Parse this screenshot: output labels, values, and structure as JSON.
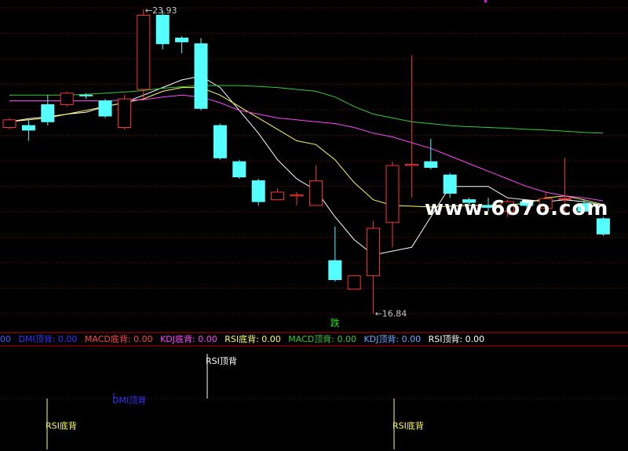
{
  "chart_data": {
    "type": "candlestick",
    "price_range": [
      16.0,
      24.0
    ],
    "grid": true,
    "candles": [
      {
        "o": 20.85,
        "c": 21.05,
        "h": 21.1,
        "l": 20.8
      },
      {
        "o": 20.9,
        "c": 20.78,
        "h": 21.05,
        "l": 20.5
      },
      {
        "o": 21.45,
        "c": 21.0,
        "h": 21.7,
        "l": 20.9
      },
      {
        "o": 21.45,
        "c": 21.75,
        "h": 21.8,
        "l": 21.4
      },
      {
        "o": 21.7,
        "c": 21.68,
        "h": 21.75,
        "l": 21.6
      },
      {
        "o": 21.55,
        "c": 21.15,
        "h": 21.6,
        "l": 21.1
      },
      {
        "o": 20.85,
        "c": 21.6,
        "h": 21.7,
        "l": 20.8
      },
      {
        "o": 21.85,
        "c": 23.8,
        "h": 23.95,
        "l": 21.6
      },
      {
        "o": 23.8,
        "c": 23.05,
        "h": 23.93,
        "l": 22.9
      },
      {
        "o": 23.2,
        "c": 23.1,
        "h": 23.25,
        "l": 22.8
      },
      {
        "o": 23.05,
        "c": 21.35,
        "h": 23.2,
        "l": 21.3
      },
      {
        "o": 20.9,
        "c": 20.05,
        "h": 20.95,
        "l": 20.0
      },
      {
        "o": 19.95,
        "c": 19.55,
        "h": 20.0,
        "l": 19.5
      },
      {
        "o": 19.45,
        "c": 18.9,
        "h": 19.5,
        "l": 18.8
      },
      {
        "o": 18.95,
        "c": 19.15,
        "h": 19.25,
        "l": 18.95
      },
      {
        "o": 19.05,
        "c": 19.08,
        "h": 19.15,
        "l": 18.8
      },
      {
        "o": 18.8,
        "c": 19.45,
        "h": 19.85,
        "l": 18.8
      },
      {
        "o": 17.35,
        "c": 16.85,
        "h": 18.25,
        "l": 16.8
      },
      {
        "o": 16.6,
        "c": 16.95,
        "h": 16.95,
        "l": 16.6
      },
      {
        "o": 16.95,
        "c": 18.2,
        "h": 18.4,
        "l": 15.96
      },
      {
        "o": 18.35,
        "c": 19.85,
        "h": 19.95,
        "l": 17.7
      },
      {
        "o": 19.85,
        "c": 19.88,
        "h": 22.75,
        "l": 19.0
      },
      {
        "o": 19.95,
        "c": 19.8,
        "h": 20.55,
        "l": 19.75
      },
      {
        "o": 19.6,
        "c": 19.12,
        "h": 19.65,
        "l": 19.0
      },
      {
        "o": 18.95,
        "c": 18.88,
        "h": 19.0,
        "l": 18.8
      },
      {
        "o": 18.8,
        "c": 18.75,
        "h": 19.0,
        "l": 18.65
      },
      {
        "o": 18.65,
        "c": 18.9,
        "h": 18.95,
        "l": 18.5
      },
      {
        "o": 18.9,
        "c": 18.8,
        "h": 18.95,
        "l": 18.75
      },
      {
        "o": 18.72,
        "c": 18.98,
        "h": 19.15,
        "l": 18.72
      },
      {
        "o": 18.98,
        "c": 18.98,
        "h": 20.05,
        "l": 18.55
      },
      {
        "o": 18.85,
        "c": 18.65,
        "h": 18.95,
        "l": 18.62
      },
      {
        "o": 18.45,
        "c": 18.05,
        "h": 18.5,
        "l": 18.0
      }
    ],
    "moving_averages": [
      {
        "name": "MA5",
        "color": "#ffffff",
        "values": [
          21.0,
          21.08,
          21.13,
          21.2,
          21.25,
          21.4,
          21.5,
          21.7,
          21.9,
          22.1,
          22.2,
          21.9,
          21.3,
          20.7,
          20.0,
          19.5,
          19.2,
          18.5,
          17.9,
          17.5,
          17.6,
          17.7,
          18.5,
          19.3,
          19.3,
          19.3,
          19.0,
          18.95,
          18.9,
          18.95,
          18.9,
          18.8
        ]
      },
      {
        "name": "MA10",
        "color": "#ffff55",
        "values": [
          21.0,
          21.05,
          21.1,
          21.2,
          21.3,
          21.4,
          21.5,
          21.6,
          21.8,
          21.9,
          21.9,
          21.7,
          21.4,
          21.1,
          20.8,
          20.5,
          20.4,
          20.0,
          19.4,
          18.95,
          18.8,
          18.78,
          18.76,
          18.78,
          18.8,
          18.8,
          18.82,
          18.85,
          19.0,
          19.05,
          18.95,
          18.82
        ]
      },
      {
        "name": "MA20",
        "color": "#ff44ff",
        "values": [
          21.55,
          21.55,
          21.55,
          21.55,
          21.55,
          21.55,
          21.57,
          21.58,
          21.65,
          21.7,
          21.65,
          21.5,
          21.3,
          21.2,
          21.1,
          21.05,
          21.0,
          20.95,
          20.85,
          20.7,
          20.6,
          20.45,
          20.3,
          20.1,
          19.9,
          19.7,
          19.5,
          19.3,
          19.15,
          19.05,
          19.0,
          18.92
        ]
      },
      {
        "name": "MA60",
        "color": "#33cc33",
        "values": [
          21.7,
          21.7,
          21.7,
          21.7,
          21.72,
          21.75,
          21.78,
          21.82,
          21.88,
          21.92,
          21.95,
          21.95,
          21.95,
          21.93,
          21.9,
          21.85,
          21.8,
          21.65,
          21.4,
          21.2,
          21.1,
          21.0,
          20.95,
          20.9,
          20.87,
          20.85,
          20.83,
          20.8,
          20.78,
          20.75,
          20.72,
          20.7
        ]
      }
    ],
    "annotations": [
      {
        "text": "23.93",
        "candle": 7,
        "price": 23.93
      },
      {
        "text": "16.84",
        "candle": 19,
        "price": 15.96
      },
      {
        "text": "跌",
        "candle": 17,
        "price": 15.75
      }
    ],
    "signals": [
      {
        "candle": 5,
        "label": "DMI顶背",
        "color": "#3333ff",
        "level": 0.45
      },
      {
        "candle": 10,
        "label": "RSI顶背",
        "color": "#ffffff",
        "level": 0.07
      },
      {
        "candle": 2,
        "label": "RSI底背",
        "color": "#ffff55",
        "level": 0.7
      },
      {
        "candle": 20,
        "label": "RSI底背",
        "color": "#ffff55",
        "level": 0.7
      }
    ]
  },
  "status_bar": {
    "items": [
      {
        "text": "00",
        "color": "#3366ff"
      },
      {
        "text": "DMI顶背: 0.00",
        "color": "#3333ff"
      },
      {
        "text": "MACD底背: 0.00",
        "color": "#ff4444"
      },
      {
        "text": "KDJ底背: 0.00",
        "color": "#ff44ff"
      },
      {
        "text": "RSI底背: 0.00",
        "color": "#ffff55"
      },
      {
        "text": "MACD顶背: 0.00",
        "color": "#33cc33"
      },
      {
        "text": "KDJ顶背: 0.00",
        "color": "#66aaff"
      },
      {
        "text": "RSI顶背: 0.00",
        "color": "#ffffff"
      }
    ]
  },
  "watermark": "www.6o7o.com",
  "colors": {
    "up": "#ff3333",
    "down": "#55ffff",
    "grid": "#8b0000",
    "divider": "#c00000",
    "annotation": "#c8c8c8",
    "fall_label": "#22dd22"
  }
}
